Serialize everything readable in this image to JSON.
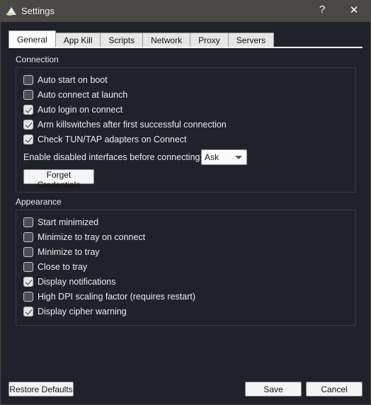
{
  "window": {
    "title": "Settings",
    "help": "?",
    "close": "✕"
  },
  "tabs": [
    "General",
    "App Kill",
    "Scripts",
    "Network",
    "Proxy",
    "Servers"
  ],
  "connection": {
    "label": "Connection",
    "options": [
      {
        "label": "Auto start on boot",
        "checked": false
      },
      {
        "label": "Auto connect at launch",
        "checked": false
      },
      {
        "label": "Auto login on connect",
        "checked": true
      },
      {
        "label": "Arm killswitches after first successful connection",
        "checked": true
      },
      {
        "label": "Check TUN/TAP adapters on Connect",
        "checked": true
      }
    ],
    "interfaces_label": "Enable disabled interfaces before connecting:",
    "interfaces_value": "Ask",
    "forget_button": "Forget Credentials"
  },
  "appearance": {
    "label": "Appearance",
    "options": [
      {
        "label": "Start minimized",
        "checked": false
      },
      {
        "label": "Minimize to tray on connect",
        "checked": false
      },
      {
        "label": "Minimize to tray",
        "checked": false
      },
      {
        "label": "Close to tray",
        "checked": false
      },
      {
        "label": "Display notifications",
        "checked": true
      },
      {
        "label": "High DPI scaling factor (requires restart)",
        "checked": false
      },
      {
        "label": "Display cipher warning",
        "checked": true
      }
    ]
  },
  "footer": {
    "restore": "Restore Defaults",
    "save": "Save",
    "cancel": "Cancel"
  }
}
